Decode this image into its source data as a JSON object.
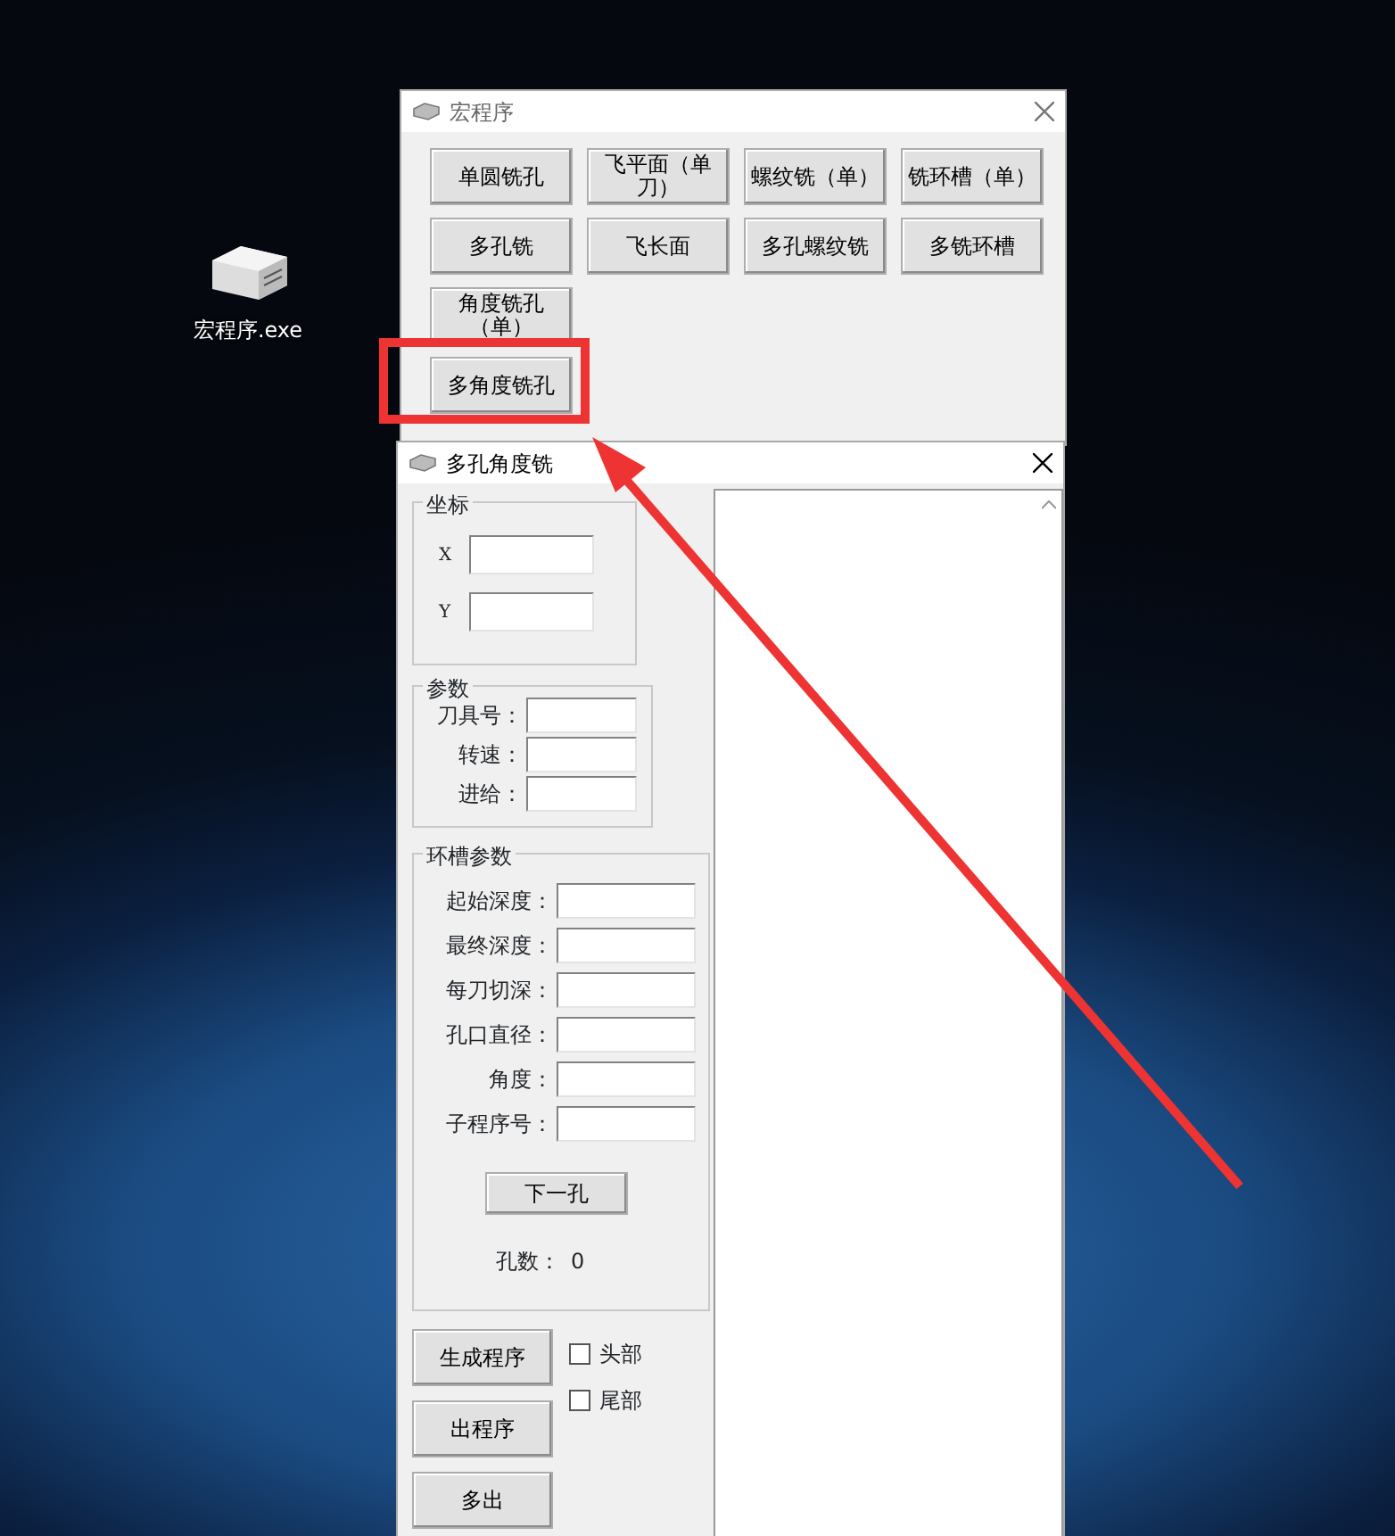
{
  "desktop": {
    "icons": [
      {
        "label": "宏程序.exe"
      }
    ]
  },
  "main_window": {
    "title": "宏程序",
    "buttons": [
      "单圆铣孔",
      "飞平面（单刀）",
      "螺纹铣（单）",
      "铣环槽（单）",
      "多孔铣",
      "飞长面",
      "多孔螺纹铣",
      "多铣环槽",
      "角度铣孔（单）",
      "多角度铣孔"
    ]
  },
  "dialog": {
    "title": "多孔角度铣",
    "coordinates": {
      "legend": "坐标",
      "fields": [
        {
          "label": "X"
        },
        {
          "label": "Y"
        }
      ]
    },
    "params": {
      "legend": "参数",
      "fields": [
        {
          "label": "刀具号："
        },
        {
          "label": "转速："
        },
        {
          "label": "进给："
        }
      ]
    },
    "groove": {
      "legend": "环槽参数",
      "fields": [
        {
          "label": "起始深度："
        },
        {
          "label": "最终深度："
        },
        {
          "label": "每刀切深："
        },
        {
          "label": "孔口直径："
        },
        {
          "label": "角度："
        },
        {
          "label": "子程序号："
        }
      ],
      "next_button": "下一孔",
      "hole_count_label": "孔数：",
      "hole_count": "0"
    },
    "actions": [
      "生成程序",
      "出程序",
      "多出"
    ],
    "checkboxes": [
      {
        "label": "头部",
        "checked": false
      },
      {
        "label": "尾部",
        "checked": false
      }
    ]
  }
}
